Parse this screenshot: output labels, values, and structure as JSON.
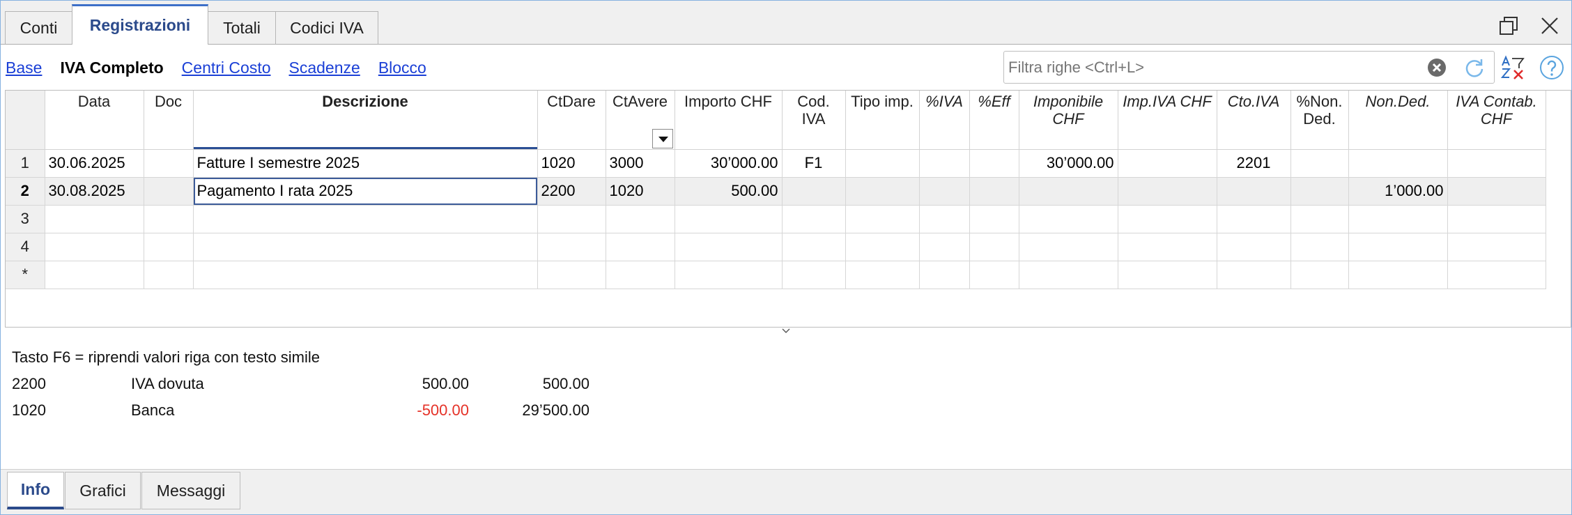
{
  "window": {
    "tabs": [
      {
        "label": "Conti",
        "active": false
      },
      {
        "label": "Registrazioni",
        "active": true
      },
      {
        "label": "Totali",
        "active": false
      },
      {
        "label": "Codici IVA",
        "active": false
      }
    ],
    "icons": {
      "restore": "restore-window-icon",
      "close": "close-icon"
    }
  },
  "views": {
    "items": [
      {
        "label": "Base",
        "active": false
      },
      {
        "label": "IVA Completo",
        "active": true
      },
      {
        "label": "Centri Costo",
        "active": false
      },
      {
        "label": "Scadenze",
        "active": false
      },
      {
        "label": "Blocco",
        "active": false
      }
    ]
  },
  "filter": {
    "placeholder": "Filtra righe <Ctrl+L>",
    "value": "",
    "icons": {
      "clear": "clear-filter-icon",
      "refresh": "refresh-icon",
      "sort_filter": "sort-filter-icon",
      "help": "help-icon"
    }
  },
  "table": {
    "columns": [
      {
        "label": "Data"
      },
      {
        "label": "Doc"
      },
      {
        "label": "Descrizione",
        "focused": true
      },
      {
        "label": "CtDare"
      },
      {
        "label": "CtAvere",
        "dropdown": true
      },
      {
        "label": "Importo CHF"
      },
      {
        "label": "Cod.\nIVA"
      },
      {
        "label": "Tipo imp."
      },
      {
        "label": "%IVA"
      },
      {
        "label": "%Eff"
      },
      {
        "label": "Imponibile\nCHF"
      },
      {
        "label": "Imp.IVA CHF"
      },
      {
        "label": "Cto.IVA"
      },
      {
        "label": "%Non.\nDed."
      },
      {
        "label": "Non.Ded."
      },
      {
        "label": "IVA Contab.\nCHF"
      }
    ],
    "rows": [
      {
        "num": "1",
        "selected": false,
        "cells": [
          "30.06.2025",
          "",
          "Fatture I semestre 2025",
          "1020",
          "3000",
          "30’000.00",
          "F1",
          "",
          "",
          "",
          "30’000.00",
          "",
          "2201",
          "",
          "",
          ""
        ]
      },
      {
        "num": "2",
        "selected": true,
        "cells": [
          "30.08.2025",
          "",
          "Pagamento I rata 2025",
          "2200",
          "1020",
          "500.00",
          "",
          "",
          "",
          "",
          "",
          "",
          "",
          "",
          "1’000.00",
          ""
        ]
      },
      {
        "num": "3",
        "selected": false,
        "cells": []
      },
      {
        "num": "4",
        "selected": false,
        "cells": []
      },
      {
        "num": "*",
        "selected": false,
        "cells": []
      }
    ]
  },
  "info": {
    "hint": "Tasto F6 = riprendi valori riga con testo simile",
    "lines": [
      {
        "account": "2200",
        "description": "IVA dovuta",
        "amount": "500.00",
        "balance": "500.00",
        "negative": false
      },
      {
        "account": "1020",
        "description": "Banca",
        "amount": "-500.00",
        "balance": "29’500.00",
        "negative": true
      }
    ]
  },
  "bottom_tabs": [
    {
      "label": "Info",
      "active": true
    },
    {
      "label": "Grafici",
      "active": false
    },
    {
      "label": "Messaggi",
      "active": false
    }
  ],
  "colors": {
    "accent": "#2b4a8b",
    "link": "#1a3fd6",
    "negative": "#e53228",
    "focus_outline": "#3c5b99",
    "window_border": "#86b2e0"
  }
}
